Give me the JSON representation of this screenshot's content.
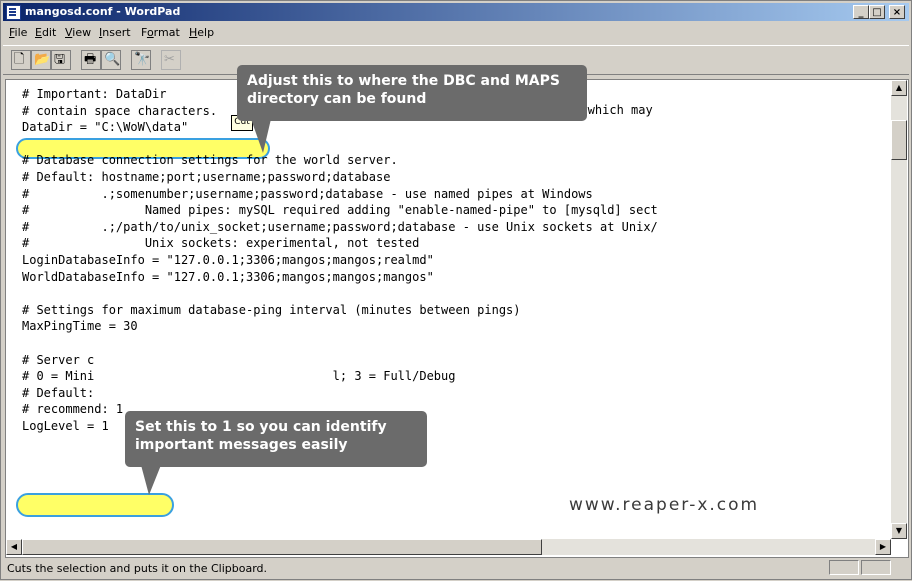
{
  "window": {
    "title": "mangosd.conf - WordPad",
    "minimize_glyph": "_",
    "maximize_glyph": "□",
    "close_glyph": "×"
  },
  "menu": [
    {
      "label": "File",
      "accel": "F",
      "rest": "ile"
    },
    {
      "label": "Edit",
      "accel": "E",
      "rest": "dit"
    },
    {
      "label": "View",
      "accel": "V",
      "rest": "iew"
    },
    {
      "label": "Insert",
      "accel": "I",
      "rest": "nsert"
    },
    {
      "label": "Format",
      "accel": "o",
      "pre": "F",
      "rest": "rmat"
    },
    {
      "label": "Help",
      "accel": "H",
      "rest": "elp"
    }
  ],
  "toolbar": {
    "icons": [
      "new-icon",
      "open-icon",
      "save-icon",
      "print-icon",
      "print-preview-icon",
      "find-icon",
      "cut-icon"
    ],
    "glyphs": [
      "🗋",
      "📂",
      "🖫",
      "🖶",
      "🔍",
      "🔭",
      "✂"
    ]
  },
  "tooltip": "Cut",
  "document": {
    "lines": [
      "# Important: DataDir",
      "# contain space characters.",
      "DataDir = \"C:\\WoW\\data\"",
      "",
      "# Database connection settings for the world server.",
      "# Default: hostname;port;username;password;database",
      "#          .;somenumber;username;password;database - use named pipes at Windows",
      "#                Named pipes: mySQL required adding \"enable-named-pipe\" to [mysqld] sect",
      "#          .;/path/to/unix_socket;username;password;database - use Unix sockets at Unix/",
      "#                Unix sockets: experimental, not tested",
      "LoginDatabaseInfo = \"127.0.0.1;3306;mangos;mangos;realmd\"",
      "WorldDatabaseInfo = \"127.0.0.1;3306;mangos;mangos;mangos\"",
      "",
      "# Settings for maximum database-ping interval (minutes between pings)",
      "MaxPingTime = 30",
      "",
      "# Server c",
      "# 0 = Mini                                 l; 3 = Full/Debug",
      "# Default:",
      "# recommend: 1",
      "LogLevel = 1"
    ],
    "hidden_fragment": "ng which may"
  },
  "callouts": {
    "datadir": "Adjust this to where the DBC and MAPS directory can be found",
    "loglevel": "Set this to 1 so you can identify important messages easily"
  },
  "watermark": "www.reaper-x.com",
  "status": {
    "text": "Cuts the selection and puts it on the Clipboard."
  }
}
